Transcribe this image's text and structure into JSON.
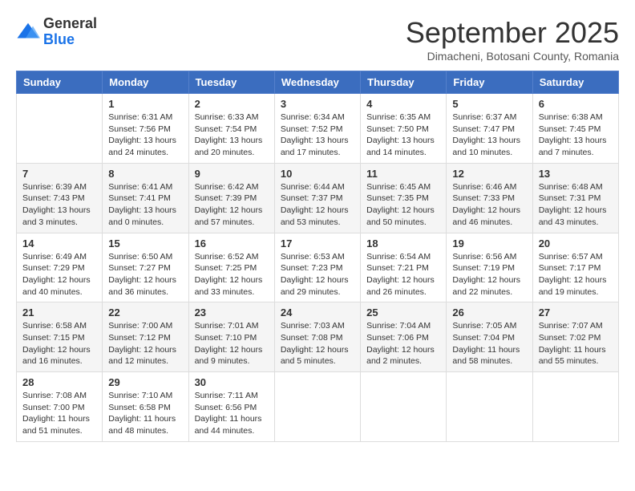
{
  "header": {
    "logo_general": "General",
    "logo_blue": "Blue",
    "month_title": "September 2025",
    "subtitle": "Dimacheni, Botosani County, Romania"
  },
  "days_of_week": [
    "Sunday",
    "Monday",
    "Tuesday",
    "Wednesday",
    "Thursday",
    "Friday",
    "Saturday"
  ],
  "weeks": [
    [
      {
        "day": "",
        "sunrise": "",
        "sunset": "",
        "daylight": ""
      },
      {
        "day": "1",
        "sunrise": "Sunrise: 6:31 AM",
        "sunset": "Sunset: 7:56 PM",
        "daylight": "Daylight: 13 hours and 24 minutes."
      },
      {
        "day": "2",
        "sunrise": "Sunrise: 6:33 AM",
        "sunset": "Sunset: 7:54 PM",
        "daylight": "Daylight: 13 hours and 20 minutes."
      },
      {
        "day": "3",
        "sunrise": "Sunrise: 6:34 AM",
        "sunset": "Sunset: 7:52 PM",
        "daylight": "Daylight: 13 hours and 17 minutes."
      },
      {
        "day": "4",
        "sunrise": "Sunrise: 6:35 AM",
        "sunset": "Sunset: 7:50 PM",
        "daylight": "Daylight: 13 hours and 14 minutes."
      },
      {
        "day": "5",
        "sunrise": "Sunrise: 6:37 AM",
        "sunset": "Sunset: 7:47 PM",
        "daylight": "Daylight: 13 hours and 10 minutes."
      },
      {
        "day": "6",
        "sunrise": "Sunrise: 6:38 AM",
        "sunset": "Sunset: 7:45 PM",
        "daylight": "Daylight: 13 hours and 7 minutes."
      }
    ],
    [
      {
        "day": "7",
        "sunrise": "Sunrise: 6:39 AM",
        "sunset": "Sunset: 7:43 PM",
        "daylight": "Daylight: 13 hours and 3 minutes."
      },
      {
        "day": "8",
        "sunrise": "Sunrise: 6:41 AM",
        "sunset": "Sunset: 7:41 PM",
        "daylight": "Daylight: 13 hours and 0 minutes."
      },
      {
        "day": "9",
        "sunrise": "Sunrise: 6:42 AM",
        "sunset": "Sunset: 7:39 PM",
        "daylight": "Daylight: 12 hours and 57 minutes."
      },
      {
        "day": "10",
        "sunrise": "Sunrise: 6:44 AM",
        "sunset": "Sunset: 7:37 PM",
        "daylight": "Daylight: 12 hours and 53 minutes."
      },
      {
        "day": "11",
        "sunrise": "Sunrise: 6:45 AM",
        "sunset": "Sunset: 7:35 PM",
        "daylight": "Daylight: 12 hours and 50 minutes."
      },
      {
        "day": "12",
        "sunrise": "Sunrise: 6:46 AM",
        "sunset": "Sunset: 7:33 PM",
        "daylight": "Daylight: 12 hours and 46 minutes."
      },
      {
        "day": "13",
        "sunrise": "Sunrise: 6:48 AM",
        "sunset": "Sunset: 7:31 PM",
        "daylight": "Daylight: 12 hours and 43 minutes."
      }
    ],
    [
      {
        "day": "14",
        "sunrise": "Sunrise: 6:49 AM",
        "sunset": "Sunset: 7:29 PM",
        "daylight": "Daylight: 12 hours and 40 minutes."
      },
      {
        "day": "15",
        "sunrise": "Sunrise: 6:50 AM",
        "sunset": "Sunset: 7:27 PM",
        "daylight": "Daylight: 12 hours and 36 minutes."
      },
      {
        "day": "16",
        "sunrise": "Sunrise: 6:52 AM",
        "sunset": "Sunset: 7:25 PM",
        "daylight": "Daylight: 12 hours and 33 minutes."
      },
      {
        "day": "17",
        "sunrise": "Sunrise: 6:53 AM",
        "sunset": "Sunset: 7:23 PM",
        "daylight": "Daylight: 12 hours and 29 minutes."
      },
      {
        "day": "18",
        "sunrise": "Sunrise: 6:54 AM",
        "sunset": "Sunset: 7:21 PM",
        "daylight": "Daylight: 12 hours and 26 minutes."
      },
      {
        "day": "19",
        "sunrise": "Sunrise: 6:56 AM",
        "sunset": "Sunset: 7:19 PM",
        "daylight": "Daylight: 12 hours and 22 minutes."
      },
      {
        "day": "20",
        "sunrise": "Sunrise: 6:57 AM",
        "sunset": "Sunset: 7:17 PM",
        "daylight": "Daylight: 12 hours and 19 minutes."
      }
    ],
    [
      {
        "day": "21",
        "sunrise": "Sunrise: 6:58 AM",
        "sunset": "Sunset: 7:15 PM",
        "daylight": "Daylight: 12 hours and 16 minutes."
      },
      {
        "day": "22",
        "sunrise": "Sunrise: 7:00 AM",
        "sunset": "Sunset: 7:12 PM",
        "daylight": "Daylight: 12 hours and 12 minutes."
      },
      {
        "day": "23",
        "sunrise": "Sunrise: 7:01 AM",
        "sunset": "Sunset: 7:10 PM",
        "daylight": "Daylight: 12 hours and 9 minutes."
      },
      {
        "day": "24",
        "sunrise": "Sunrise: 7:03 AM",
        "sunset": "Sunset: 7:08 PM",
        "daylight": "Daylight: 12 hours and 5 minutes."
      },
      {
        "day": "25",
        "sunrise": "Sunrise: 7:04 AM",
        "sunset": "Sunset: 7:06 PM",
        "daylight": "Daylight: 12 hours and 2 minutes."
      },
      {
        "day": "26",
        "sunrise": "Sunrise: 7:05 AM",
        "sunset": "Sunset: 7:04 PM",
        "daylight": "Daylight: 11 hours and 58 minutes."
      },
      {
        "day": "27",
        "sunrise": "Sunrise: 7:07 AM",
        "sunset": "Sunset: 7:02 PM",
        "daylight": "Daylight: 11 hours and 55 minutes."
      }
    ],
    [
      {
        "day": "28",
        "sunrise": "Sunrise: 7:08 AM",
        "sunset": "Sunset: 7:00 PM",
        "daylight": "Daylight: 11 hours and 51 minutes."
      },
      {
        "day": "29",
        "sunrise": "Sunrise: 7:10 AM",
        "sunset": "Sunset: 6:58 PM",
        "daylight": "Daylight: 11 hours and 48 minutes."
      },
      {
        "day": "30",
        "sunrise": "Sunrise: 7:11 AM",
        "sunset": "Sunset: 6:56 PM",
        "daylight": "Daylight: 11 hours and 44 minutes."
      },
      {
        "day": "",
        "sunrise": "",
        "sunset": "",
        "daylight": ""
      },
      {
        "day": "",
        "sunrise": "",
        "sunset": "",
        "daylight": ""
      },
      {
        "day": "",
        "sunrise": "",
        "sunset": "",
        "daylight": ""
      },
      {
        "day": "",
        "sunrise": "",
        "sunset": "",
        "daylight": ""
      }
    ]
  ]
}
